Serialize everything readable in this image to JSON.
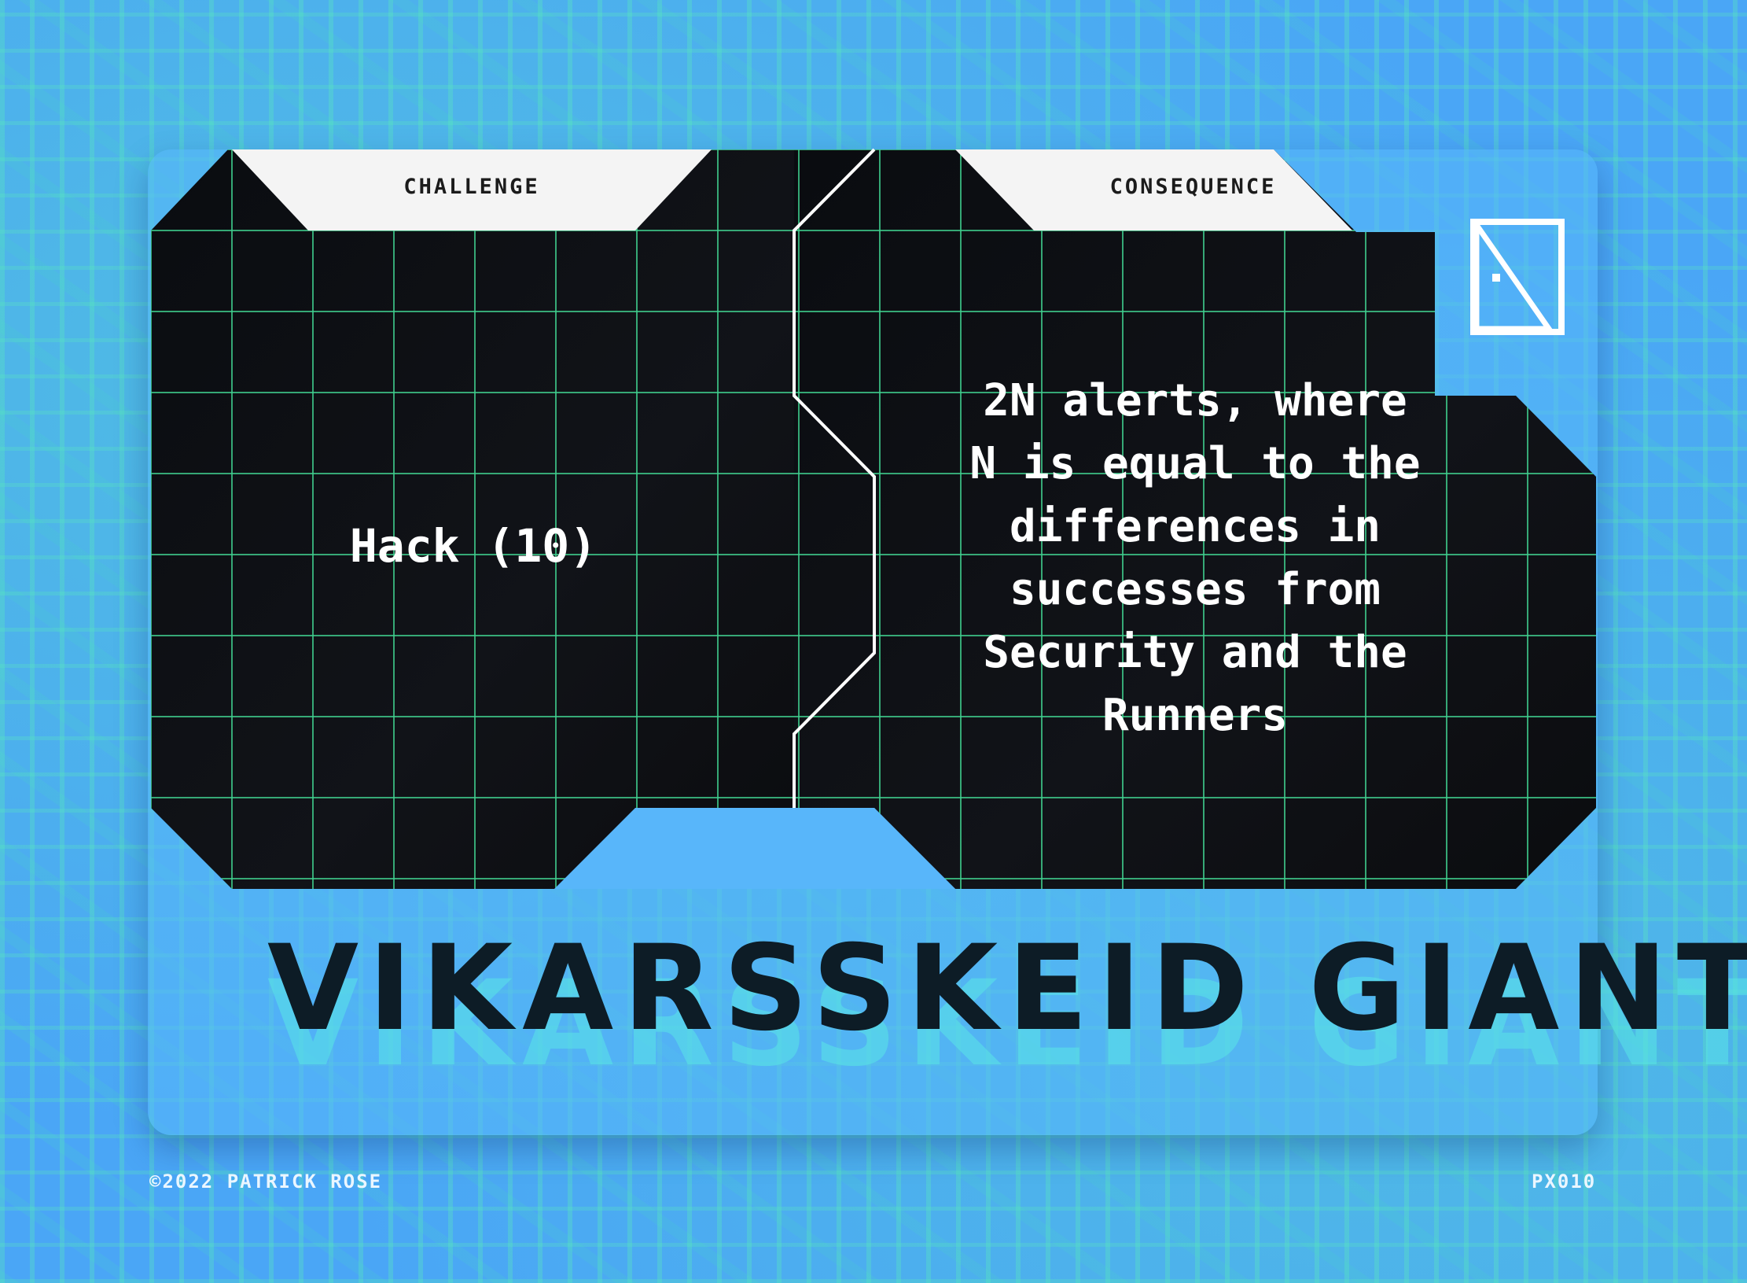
{
  "card": {
    "challenge_label": "CHALLENGE",
    "consequence_label": "CONSEQUENCE",
    "challenge_text": "Hack (10)",
    "consequence_lines": [
      "2N alerts, where",
      "N is equal to the",
      "differences in",
      "successes from",
      "Security and the",
      "Runners"
    ],
    "title": "VIKARSSKEID GIANT",
    "copyright": "©2022 PATRICK ROSE",
    "card_code": "PX010",
    "icon": "door-icon"
  },
  "colors": {
    "background": "#4aa6f6",
    "grid_line": "#3fcf8e",
    "cell_fill": "#0b0d12",
    "divider": "#ffffff",
    "title": "#0d1c26",
    "title_shadow": "#5ae6e6"
  }
}
